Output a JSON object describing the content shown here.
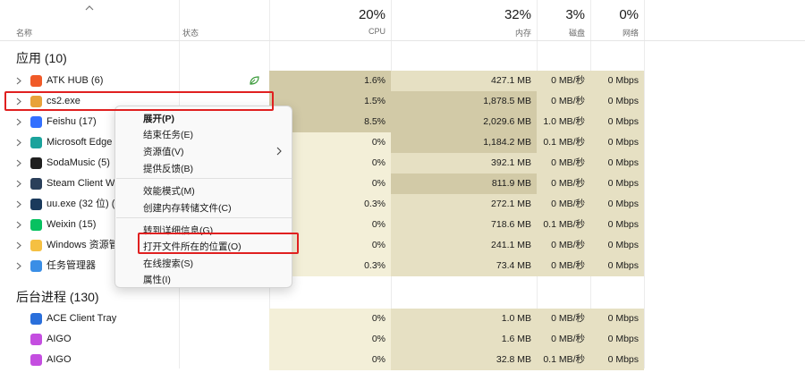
{
  "header": {
    "sort_caret": "chevron-up-icon",
    "name_label": "名称",
    "status_label": "状态",
    "cpu_pct": "20%",
    "cpu_label": "CPU",
    "mem_pct": "32%",
    "mem_label": "内存",
    "disk_pct": "3%",
    "disk_label": "磁盘",
    "net_pct": "0%",
    "net_label": "网络"
  },
  "apps_section": {
    "title": "应用 (10)"
  },
  "apps": [
    {
      "name": "ATK HUB (6)",
      "icon": "atk-hub-icon",
      "icon_color": "#f05a28",
      "cpu": "1.6%",
      "mem": "427.1 MB",
      "disk": "0 MB/秒",
      "net": "0 Mbps",
      "status_icon": "efficiency-leaf-icon"
    },
    {
      "name": "cs2.exe",
      "icon": "cs2-icon",
      "icon_color": "#e8a23a",
      "cpu": "1.5%",
      "mem": "1,878.5 MB",
      "disk": "0 MB/秒",
      "net": "0 Mbps"
    },
    {
      "name": "Feishu (17)",
      "icon": "feishu-icon",
      "icon_color": "#3370ff",
      "cpu": "8.5%",
      "mem": "2,029.6 MB",
      "disk": "1.0 MB/秒",
      "net": "0 Mbps"
    },
    {
      "name": "Microsoft Edge",
      "icon": "edge-icon",
      "icon_color": "#1ba39c",
      "cpu": "0%",
      "mem": "1,184.2 MB",
      "disk": "0.1 MB/秒",
      "net": "0 Mbps"
    },
    {
      "name": "SodaMusic (5)",
      "icon": "sodamusic-icon",
      "icon_color": "#1f1f1f",
      "cpu": "0%",
      "mem": "392.1 MB",
      "disk": "0 MB/秒",
      "net": "0 Mbps"
    },
    {
      "name": "Steam Client W",
      "icon": "steam-icon",
      "icon_color": "#2a3f5a",
      "cpu": "0%",
      "mem": "811.9 MB",
      "disk": "0 MB/秒",
      "net": "0 Mbps"
    },
    {
      "name": "uu.exe (32 位) (3",
      "icon": "uu-icon",
      "icon_color": "#1a3a5c",
      "cpu": "0.3%",
      "mem": "272.1 MB",
      "disk": "0 MB/秒",
      "net": "0 Mbps"
    },
    {
      "name": "Weixin (15)",
      "icon": "weixin-icon",
      "icon_color": "#07c160",
      "cpu": "0%",
      "mem": "718.6 MB",
      "disk": "0.1 MB/秒",
      "net": "0 Mbps"
    },
    {
      "name": "Windows 资源管",
      "icon": "folder-icon",
      "icon_color": "#f5c042",
      "cpu": "0%",
      "mem": "241.1 MB",
      "disk": "0 MB/秒",
      "net": "0 Mbps"
    },
    {
      "name": "任务管理器",
      "icon": "task-manager-icon",
      "icon_color": "#3a8ee6",
      "cpu": "0.3%",
      "mem": "73.4 MB",
      "disk": "0 MB/秒",
      "net": "0 Mbps"
    }
  ],
  "bg_section": {
    "title": "后台进程 (130)"
  },
  "bg_processes": [
    {
      "name": "ACE Client Tray",
      "icon": "ace-client-icon",
      "icon_color": "#2a6fdb",
      "cpu": "0%",
      "mem": "1.0 MB",
      "disk": "0 MB/秒",
      "net": "0 Mbps"
    },
    {
      "name": "AIGO",
      "icon": "aigo-icon",
      "icon_color": "#c44ee0",
      "cpu": "0%",
      "mem": "1.6 MB",
      "disk": "0 MB/秒",
      "net": "0 Mbps"
    },
    {
      "name": "AIGO",
      "icon": "aigo-icon",
      "icon_color": "#c44ee0",
      "cpu": "0%",
      "mem": "32.8 MB",
      "disk": "0.1 MB/秒",
      "net": "0 Mbps"
    }
  ],
  "context_menu": {
    "expand": "展开(P)",
    "end_task": "结束任务(E)",
    "resource_values": "资源值(V)",
    "feedback": "提供反馈(B)",
    "efficiency_mode": "效能模式(M)",
    "create_dump": "创建内存转储文件(C)",
    "go_to_details": "转到详细信息(G)",
    "open_file_location": "打开文件所在的位置(O)",
    "search_online": "在线搜索(S)",
    "properties": "属性(I)"
  },
  "colors": {
    "heat_low": "#f3efd8",
    "heat_mid": "#e6e0c3",
    "heat_high": "#d2caa7",
    "highlight": "#e02020"
  }
}
